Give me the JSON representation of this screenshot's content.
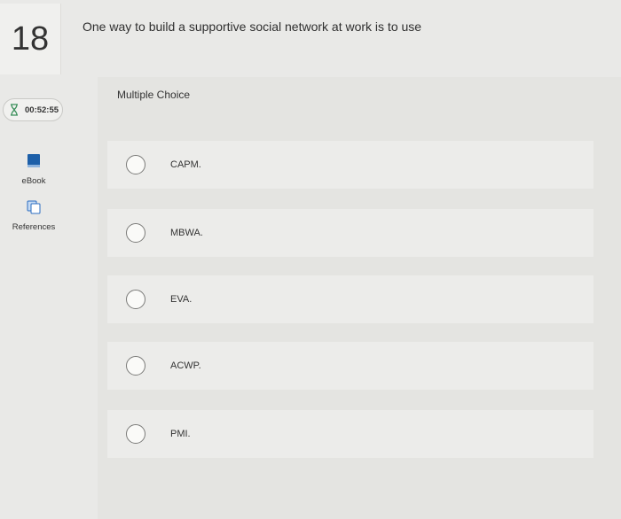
{
  "question": {
    "number": "18",
    "prompt": "One way to build a supportive social network at work is to use",
    "type_label": "Multiple Choice"
  },
  "timer": {
    "value": "00:52:55",
    "icon": "hourglass-icon",
    "color": "#3a8f5a"
  },
  "tools": [
    {
      "label": "eBook",
      "icon": "book-icon",
      "color": "#1d5fa8"
    },
    {
      "label": "References",
      "icon": "references-icon",
      "color": "#2a6cc0"
    }
  ],
  "options": [
    {
      "label": "CAPM."
    },
    {
      "label": "MBWA."
    },
    {
      "label": "EVA."
    },
    {
      "label": "ACWP."
    },
    {
      "label": "PMI."
    }
  ]
}
